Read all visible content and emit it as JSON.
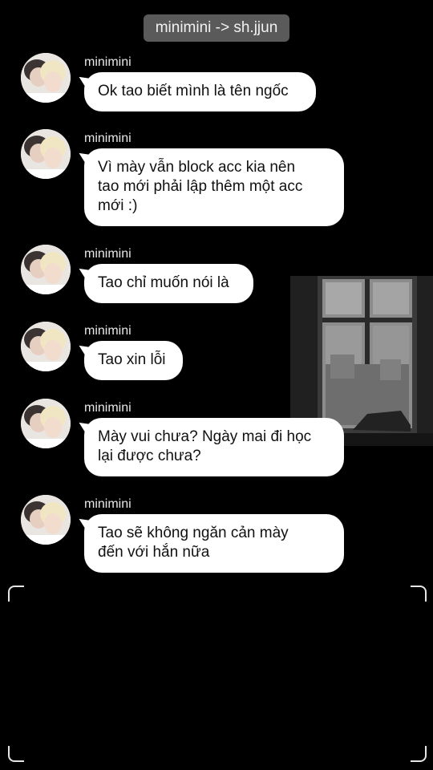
{
  "header": {
    "title": "minimini -> sh.jjun"
  },
  "messages": [
    {
      "sender": "minimini",
      "text": "Ok tao biết mình là tên ngốc"
    },
    {
      "sender": "minimini",
      "text": " Vì mày vẫn block acc kia nên\ntao mới phải lập thêm một acc\nmới :)"
    },
    {
      "sender": "minimini",
      "text": "Tao chỉ muốn nói là"
    },
    {
      "sender": "minimini",
      "text": "Tao xin lỗi"
    },
    {
      "sender": "minimini",
      "text": " Mày vui chưa? Ngày mai đi học\nlại được chưa?"
    },
    {
      "sender": "minimini",
      "text": " Tao sẽ không ngăn cản mày\nđến với hắn nữa"
    }
  ],
  "colors": {
    "background": "#000000",
    "header_pill": "#5a5a5a",
    "bubble": "#ffffff",
    "sender_text": "#e8e8e8"
  },
  "icons": {
    "avatar": "profile-photo",
    "frame": "camera-frame-corners"
  }
}
